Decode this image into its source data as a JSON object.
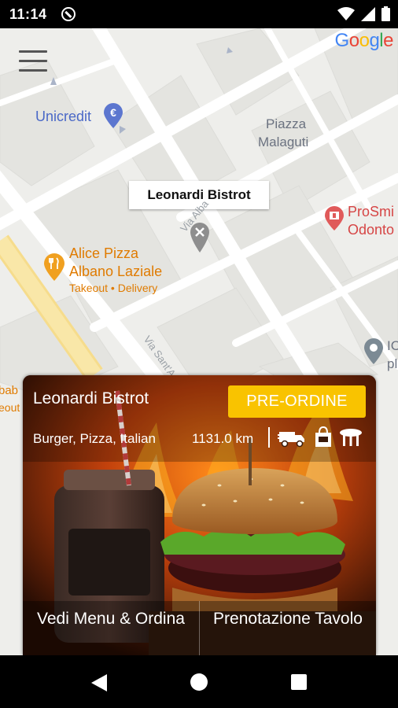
{
  "status_bar": {
    "time": "11:14",
    "icons": [
      "do-not-disturb-icon",
      "wifi-icon",
      "cellular-icon",
      "battery-icon"
    ]
  },
  "map": {
    "logo": [
      "G",
      "o",
      "o",
      "g",
      "l",
      "e"
    ],
    "logo_colors": [
      "#4285F4",
      "#EA4335",
      "#FBBC05",
      "#4285F4",
      "#34A853",
      "#EA4335"
    ],
    "pois": {
      "unicredit": "Unicredit",
      "piazza_line1": "Piazza",
      "piazza_line2": "Malaguti",
      "prosmile_line1": "ProSmi",
      "prosmile_line2": "Odonto",
      "alice_line1": "Alice Pizza",
      "alice_line2": "Albano Laziale",
      "alice_sub": "Takeout • Delivery",
      "street_sant": "Via Sant'A",
      "street_via": "Via Alba",
      "edge_right1": "IC",
      "edge_right2": "pl",
      "edge_left1": "bab",
      "edge_left2": "eout"
    },
    "marker_info": "Leonardi Bistrot"
  },
  "card": {
    "name": "Leonardi Bistrot",
    "preorder_label": "PRE-ORDINE",
    "cuisine": "Burger, Pizza, Italian",
    "distance": "1131.0 km",
    "services": [
      "delivery-truck-icon",
      "takeaway-bag-icon",
      "dine-in-table-icon"
    ],
    "menu_button_label": "Vedi Menu & Ordina",
    "reserve_button_label": "Prenotazione Tavolo"
  },
  "colors": {
    "accent_yellow": "#f9c300",
    "poi_blue": "#4a68c7",
    "poi_orange": "#e07b00",
    "poi_red": "#d64545"
  }
}
